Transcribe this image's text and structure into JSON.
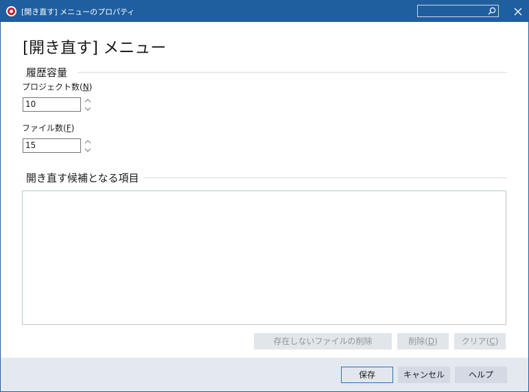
{
  "window": {
    "title": "[開き直す] メニューのプロパティ",
    "search_value": ""
  },
  "page": {
    "heading": "[開き直す] メニュー"
  },
  "history": {
    "group_title": "履歴容量",
    "project_label": "プロジェクト数(",
    "project_mnemonic": "N",
    "project_label_end": ")",
    "project_value": "10",
    "file_label": "ファイル数(",
    "file_mnemonic": "F",
    "file_label_end": ")",
    "file_value": "15"
  },
  "candidates": {
    "group_title": "開き直す候補となる項目",
    "items": []
  },
  "actions": {
    "remove_missing": "存在しないファイルの削除",
    "delete_label": "削除(",
    "delete_mnemonic": "D",
    "clear_label": "クリア(",
    "clear_mnemonic": "C",
    "paren_close": ")"
  },
  "footer": {
    "save": "保存",
    "cancel": "キャンセル",
    "help": "ヘルプ"
  },
  "icons": {
    "app": "app-logo-icon",
    "search": "search-icon",
    "close": "close-icon",
    "spin": "spin-updown-icon"
  },
  "colors": {
    "titlebar": "#1f5fa0",
    "footer": "#e4e9ef",
    "accent": "#c81e28"
  }
}
